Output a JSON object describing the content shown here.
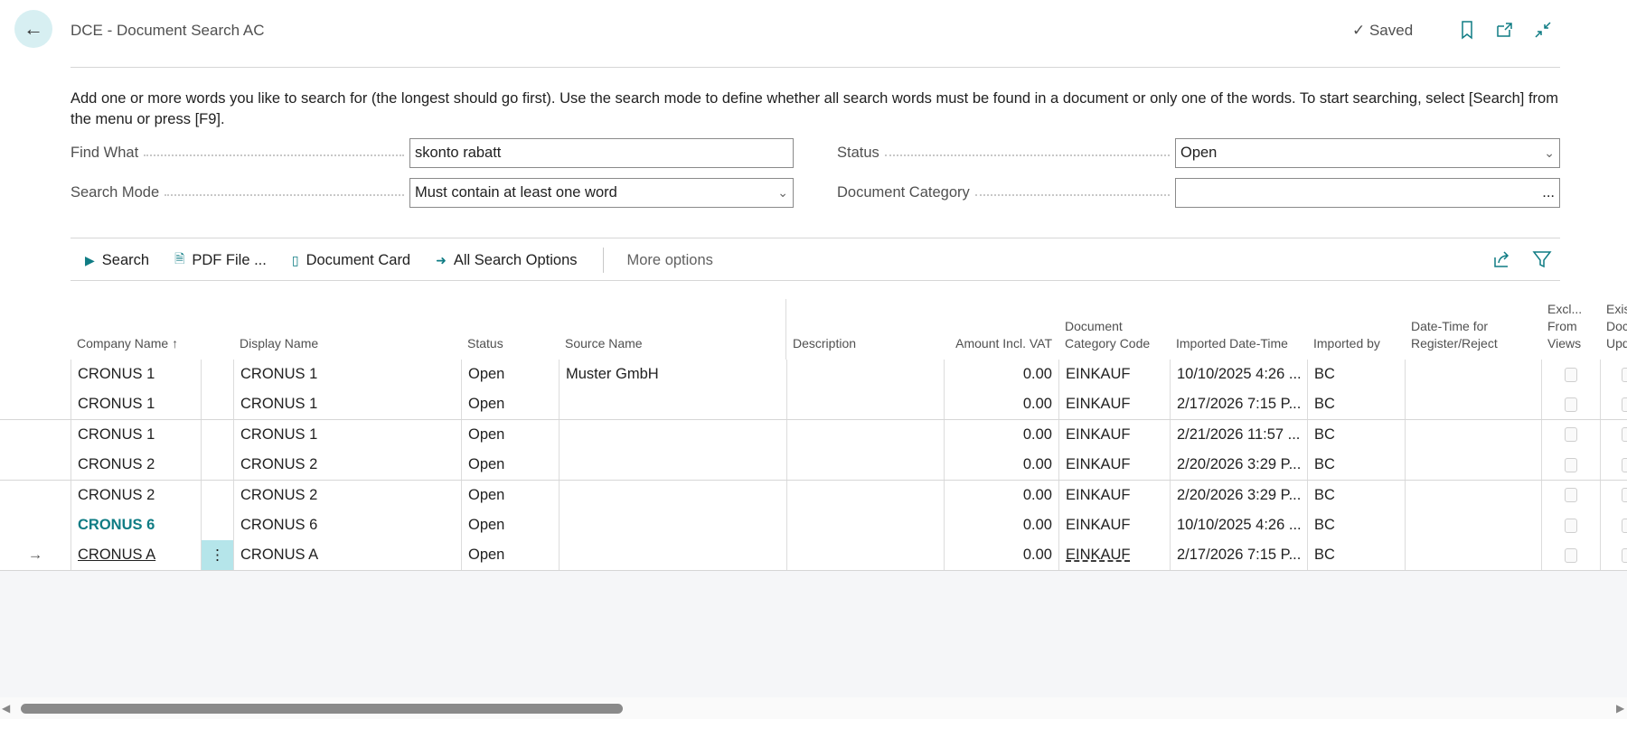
{
  "header": {
    "title": "DCE - Document Search AC",
    "saved": "Saved",
    "icons": [
      "back-arrow-icon",
      "bookmark-icon",
      "open-new-window-icon",
      "collapse-icon"
    ]
  },
  "description": "Add one or more words you like to search for (the longest should go first). Use the search mode to define whether all search words must be found in a document or only one of the words. To start searching, select [Search] from the menu or press [F9].",
  "fields": {
    "find_what": {
      "label": "Find What",
      "value": "skonto rabatt"
    },
    "search_mode": {
      "label": "Search Mode",
      "value": "Must contain at least one word"
    },
    "status": {
      "label": "Status",
      "value": "Open"
    },
    "document_category": {
      "label": "Document Category",
      "value": "",
      "lookup": "..."
    }
  },
  "toolbar": {
    "search": "Search",
    "pdf_file": "PDF File ...",
    "document_card": "Document Card",
    "all_search_options": "All Search Options",
    "more_options": "More options"
  },
  "columns": [
    "Company Name",
    "",
    "Display Name",
    "Status",
    "Source Name",
    "Description",
    "Amount Incl. VAT",
    "Document Category Code",
    "Imported Date-Time",
    "Imported by",
    "Date-Time for Register/Reject",
    "Excl... From Views",
    "Exis... Doc... Upd..."
  ],
  "sort_indicator": "↑",
  "rows": [
    {
      "company": "CRONUS 1",
      "display": "CRONUS 1",
      "status": "Open",
      "source": "Muster GmbH",
      "description": "",
      "amount": "0.00",
      "category": "EINKAUF",
      "imported": "10/10/2025 4:26 ...",
      "by": "BC",
      "register": ""
    },
    {
      "company": "CRONUS 1",
      "display": "CRONUS 1",
      "status": "Open",
      "source": "",
      "description": "",
      "amount": "0.00",
      "category": "EINKAUF",
      "imported": "2/17/2026 7:15 P...",
      "by": "BC",
      "register": ""
    },
    {
      "company": "CRONUS 1",
      "display": "CRONUS 1",
      "status": "Open",
      "source": "",
      "description": "",
      "amount": "0.00",
      "category": "EINKAUF",
      "imported": "2/21/2026 11:57 ...",
      "by": "BC",
      "register": ""
    },
    {
      "company": "CRONUS 2",
      "display": "CRONUS 2",
      "status": "Open",
      "source": "",
      "description": "",
      "amount": "0.00",
      "category": "EINKAUF",
      "imported": "2/20/2026 3:29 P...",
      "by": "BC",
      "register": ""
    },
    {
      "company": "CRONUS 2",
      "display": "CRONUS 2",
      "status": "Open",
      "source": "",
      "description": "",
      "amount": "0.00",
      "category": "EINKAUF",
      "imported": "2/20/2026 3:29 P...",
      "by": "BC",
      "register": ""
    },
    {
      "company": "CRONUS 6",
      "display": "CRONUS 6",
      "status": "Open",
      "source": "",
      "description": "",
      "amount": "0.00",
      "category": "EINKAUF",
      "imported": "10/10/2025 4:26 ...",
      "by": "BC",
      "register": ""
    },
    {
      "company": "CRONUS A",
      "display": "CRONUS A",
      "status": "Open",
      "source": "",
      "description": "",
      "amount": "0.00",
      "category": "EINKAUF",
      "imported": "2/17/2026 7:15 P...",
      "by": "BC",
      "register": "",
      "selected": true
    }
  ],
  "colors": {
    "accent": "#0f7c84",
    "selected_cell": "#b5e5ea",
    "back_button": "#d7eff2"
  }
}
